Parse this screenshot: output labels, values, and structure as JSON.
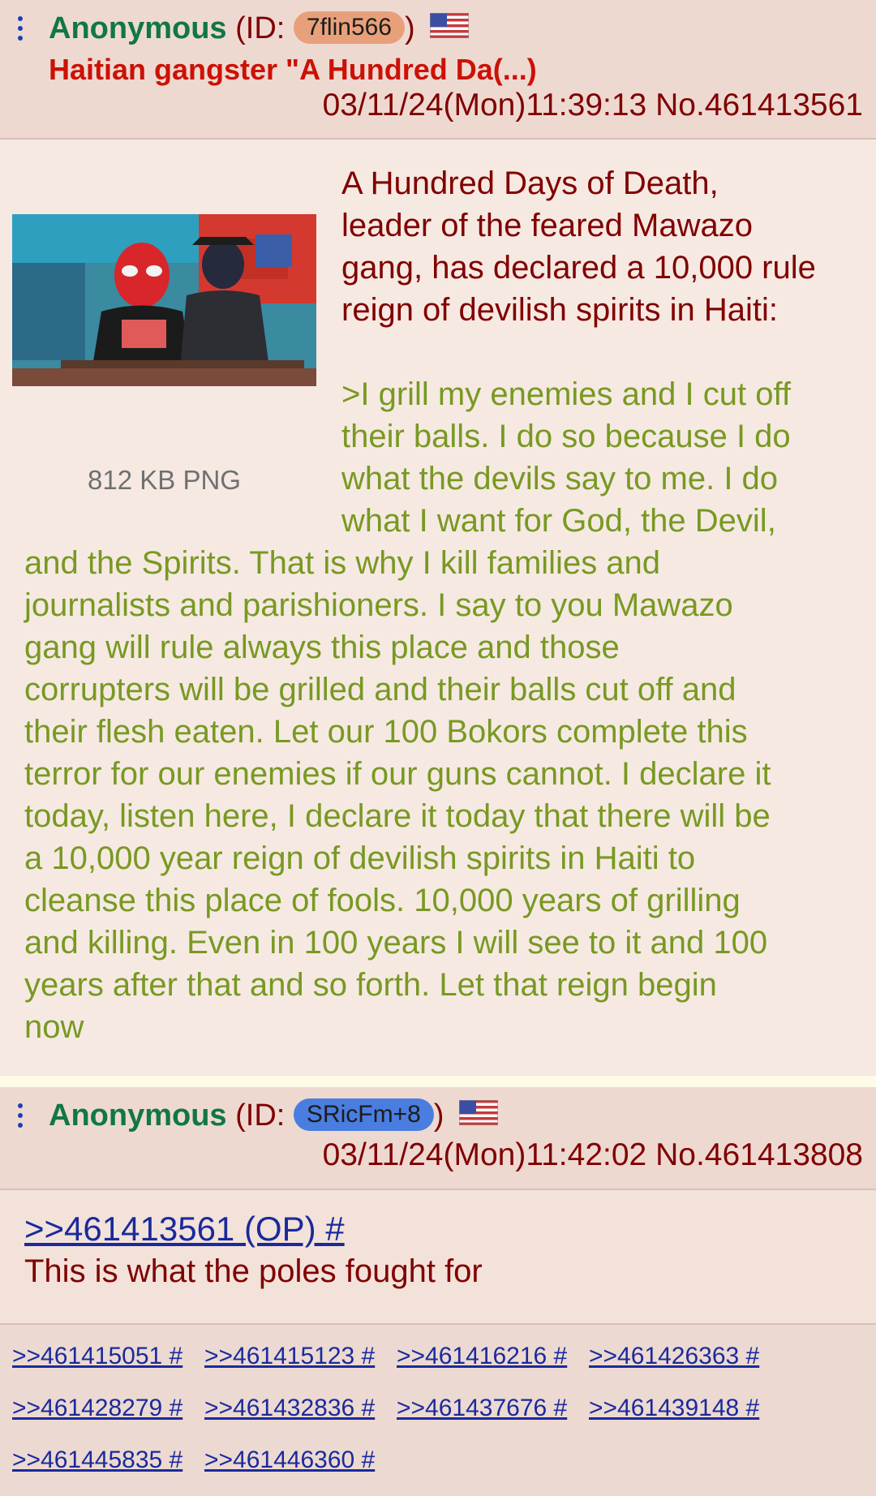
{
  "post1": {
    "name": "Anonymous",
    "id_prefix": "(ID: ",
    "id_value": "7flin566",
    "id_suffix": ")",
    "id_color": "#e7a07a",
    "subject": "Haitian gangster \"A Hundred Da(...)",
    "datetime": "03/11/24(Mon)11:39:13",
    "post_number": "No.461413561",
    "file_info": "812 KB PNG",
    "message_lines": [
      "A Hundred Days of Death,",
      "leader of the feared Mawazo",
      "gang, has declared a 10,000 rule",
      "reign of devilish spirits in Haiti:"
    ],
    "greentext_lines": [
      ">I grill my enemies and I cut off",
      "their balls. I do so because I do",
      "what the devils say to me. I do",
      "what I want for God, the Devil,",
      "and the Spirits. That is why I kill families and",
      "journalists and parishioners. I say to you Mawazo",
      "gang will rule always this place and those",
      "corrupters will be grilled and their balls cut off and",
      "their flesh eaten. Let our 100 Bokors complete this",
      "terror for our enemies if our guns cannot. I declare it",
      "today, listen here, I declare it today that there will be",
      "a 10,000 year reign of devilish spirits in Haiti to",
      "cleanse this place of fools. 10,000 years of grilling",
      "and killing. Even in 100 years I will see to it and 100",
      "years after that and so forth. Let that reign begin",
      "now"
    ]
  },
  "post2": {
    "name": "Anonymous",
    "id_prefix": "(ID: ",
    "id_value": "SRicFm+8",
    "id_suffix": ")",
    "id_color": "#4a7de0",
    "datetime": "03/11/24(Mon)11:42:02",
    "post_number": "No.461413808",
    "quote_link": ">>461413561 (OP) #",
    "message": "This is what the poles fought for",
    "backlinks": [
      ">>461415051 #",
      ">>461415123 #",
      ">>461416216 #",
      ">>461426363 #",
      ">>461428279 #",
      ">>461432836 #",
      ">>461437676 #",
      ">>461439148 #",
      ">>461445835 #",
      ">>461446360 #"
    ]
  },
  "icons": {
    "menu": "vertical-dots-icon",
    "flag": "us-flag-icon"
  },
  "colors": {
    "name_green": "#117743",
    "text_maroon": "#800000",
    "subject_red": "#cc1105",
    "greentext": "#789922",
    "link_blue": "#1a2a9c",
    "menu_blue": "#1a3fb7"
  }
}
